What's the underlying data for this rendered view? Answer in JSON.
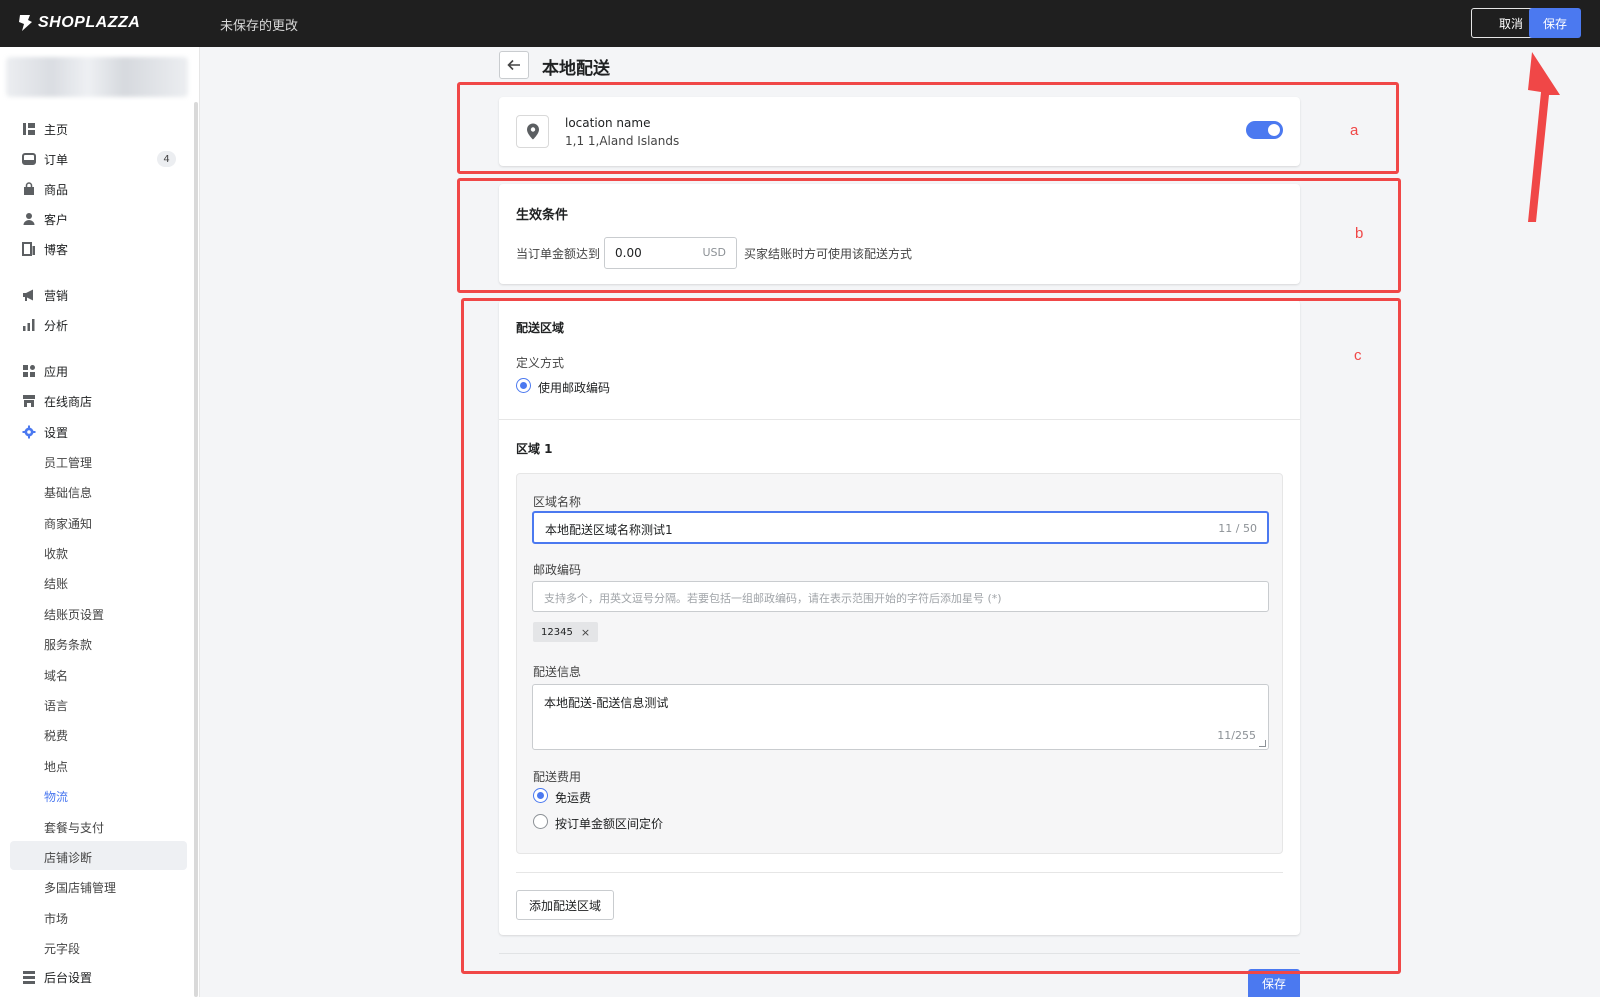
{
  "topbar": {
    "logo_text": "SHOPLAZZA",
    "unsaved_text": "未保存的更改",
    "cancel_label": "取消",
    "save_label": "保存"
  },
  "sidebar": {
    "items": [
      {
        "label": "主页",
        "icon": "home-icon"
      },
      {
        "label": "订单",
        "icon": "inbox-icon",
        "badge": "4"
      },
      {
        "label": "商品",
        "icon": "bag-icon"
      },
      {
        "label": "客户",
        "icon": "person-icon"
      },
      {
        "label": "博客",
        "icon": "blog-icon"
      },
      {
        "label": "营销",
        "icon": "megaphone-icon"
      },
      {
        "label": "分析",
        "icon": "bar-chart-icon"
      },
      {
        "label": "应用",
        "icon": "apps-icon"
      },
      {
        "label": "在线商店",
        "icon": "store-icon"
      },
      {
        "label": "设置",
        "icon": "gear-icon"
      }
    ],
    "settings_sub": [
      "员工管理",
      "基础信息",
      "商家通知",
      "收款",
      "结账",
      "结账页设置",
      "服务条款",
      "域名",
      "语言",
      "税费",
      "地点",
      "物流",
      "套餐与支付",
      "店铺诊断",
      "多国店铺管理",
      "市场",
      "元字段"
    ],
    "active_sub": "物流",
    "bottom_item": {
      "label": "后台设置",
      "icon": "admin-icon"
    }
  },
  "page": {
    "title": "本地配送"
  },
  "location": {
    "name": "location name",
    "address": "1,1 1,Aland Islands",
    "enabled": true
  },
  "condition": {
    "title": "生效条件",
    "label": "当订单金额达到",
    "amount": "0.00",
    "currency": "USD",
    "suffix": "买家结账时方可使用该配送方式"
  },
  "zones": {
    "title": "配送区域",
    "define_label": "定义方式",
    "define_option": "使用邮政编码",
    "region_title": "区域 1",
    "name_label": "区域名称",
    "name_value": "本地配送区域名称测试1",
    "name_count": "11 / 50",
    "zip_label": "邮政编码",
    "zip_placeholder": "支持多个，用英文逗号分隔。若要包括一组邮政编码，请在表示范围开始的字符后添加星号 (*)",
    "zip_tag": "12345",
    "info_label": "配送信息",
    "info_value": "本地配送-配送信息测试",
    "info_count": "11/255",
    "fee_label": "配送费用",
    "fee_options": [
      "免运费",
      "按订单金额区间定价"
    ],
    "fee_selected": "免运费",
    "add_zone_label": "添加配送区域"
  },
  "annotations": {
    "a": "a",
    "b": "b",
    "c": "c",
    "color": "#f04747"
  },
  "colors": {
    "accent": "#4b79f0",
    "topbar": "#1f1f1f"
  }
}
